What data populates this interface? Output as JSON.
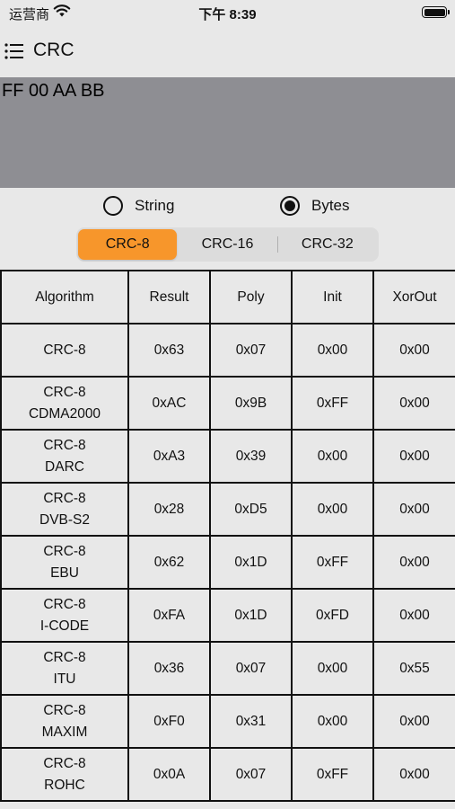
{
  "status_bar": {
    "carrier": "运营商",
    "time": "下午 8:39"
  },
  "nav": {
    "title": "CRC"
  },
  "input": {
    "value": "FF 00 AA BB"
  },
  "radio": {
    "string_label": "String",
    "bytes_label": "Bytes",
    "selected": "Bytes"
  },
  "segments": {
    "items": [
      "CRC-8",
      "CRC-16",
      "CRC-32"
    ],
    "selected": "CRC-8"
  },
  "table": {
    "headers": [
      "Algorithm",
      "Result",
      "Poly",
      "Init",
      "XorOut"
    ],
    "rows": [
      {
        "name": "CRC-8",
        "variant": "",
        "result": "0x63",
        "poly": "0x07",
        "init": "0x00",
        "xorout": "0x00"
      },
      {
        "name": "CRC-8",
        "variant": "CDMA2000",
        "result": "0xAC",
        "poly": "0x9B",
        "init": "0xFF",
        "xorout": "0x00"
      },
      {
        "name": "CRC-8",
        "variant": "DARC",
        "result": "0xA3",
        "poly": "0x39",
        "init": "0x00",
        "xorout": "0x00"
      },
      {
        "name": "CRC-8",
        "variant": "DVB-S2",
        "result": "0x28",
        "poly": "0xD5",
        "init": "0x00",
        "xorout": "0x00"
      },
      {
        "name": "CRC-8",
        "variant": "EBU",
        "result": "0x62",
        "poly": "0x1D",
        "init": "0xFF",
        "xorout": "0x00"
      },
      {
        "name": "CRC-8",
        "variant": "I-CODE",
        "result": "0xFA",
        "poly": "0x1D",
        "init": "0xFD",
        "xorout": "0x00"
      },
      {
        "name": "CRC-8",
        "variant": "ITU",
        "result": "0x36",
        "poly": "0x07",
        "init": "0x00",
        "xorout": "0x55"
      },
      {
        "name": "CRC-8",
        "variant": "MAXIM",
        "result": "0xF0",
        "poly": "0x31",
        "init": "0x00",
        "xorout": "0x00"
      },
      {
        "name": "CRC-8",
        "variant": "ROHC",
        "result": "0x0A",
        "poly": "0x07",
        "init": "0xFF",
        "xorout": "0x00"
      }
    ]
  },
  "colors": {
    "accent": "#f7962b",
    "input_bg": "#8e8e93",
    "page_bg": "#e8e8e8"
  }
}
